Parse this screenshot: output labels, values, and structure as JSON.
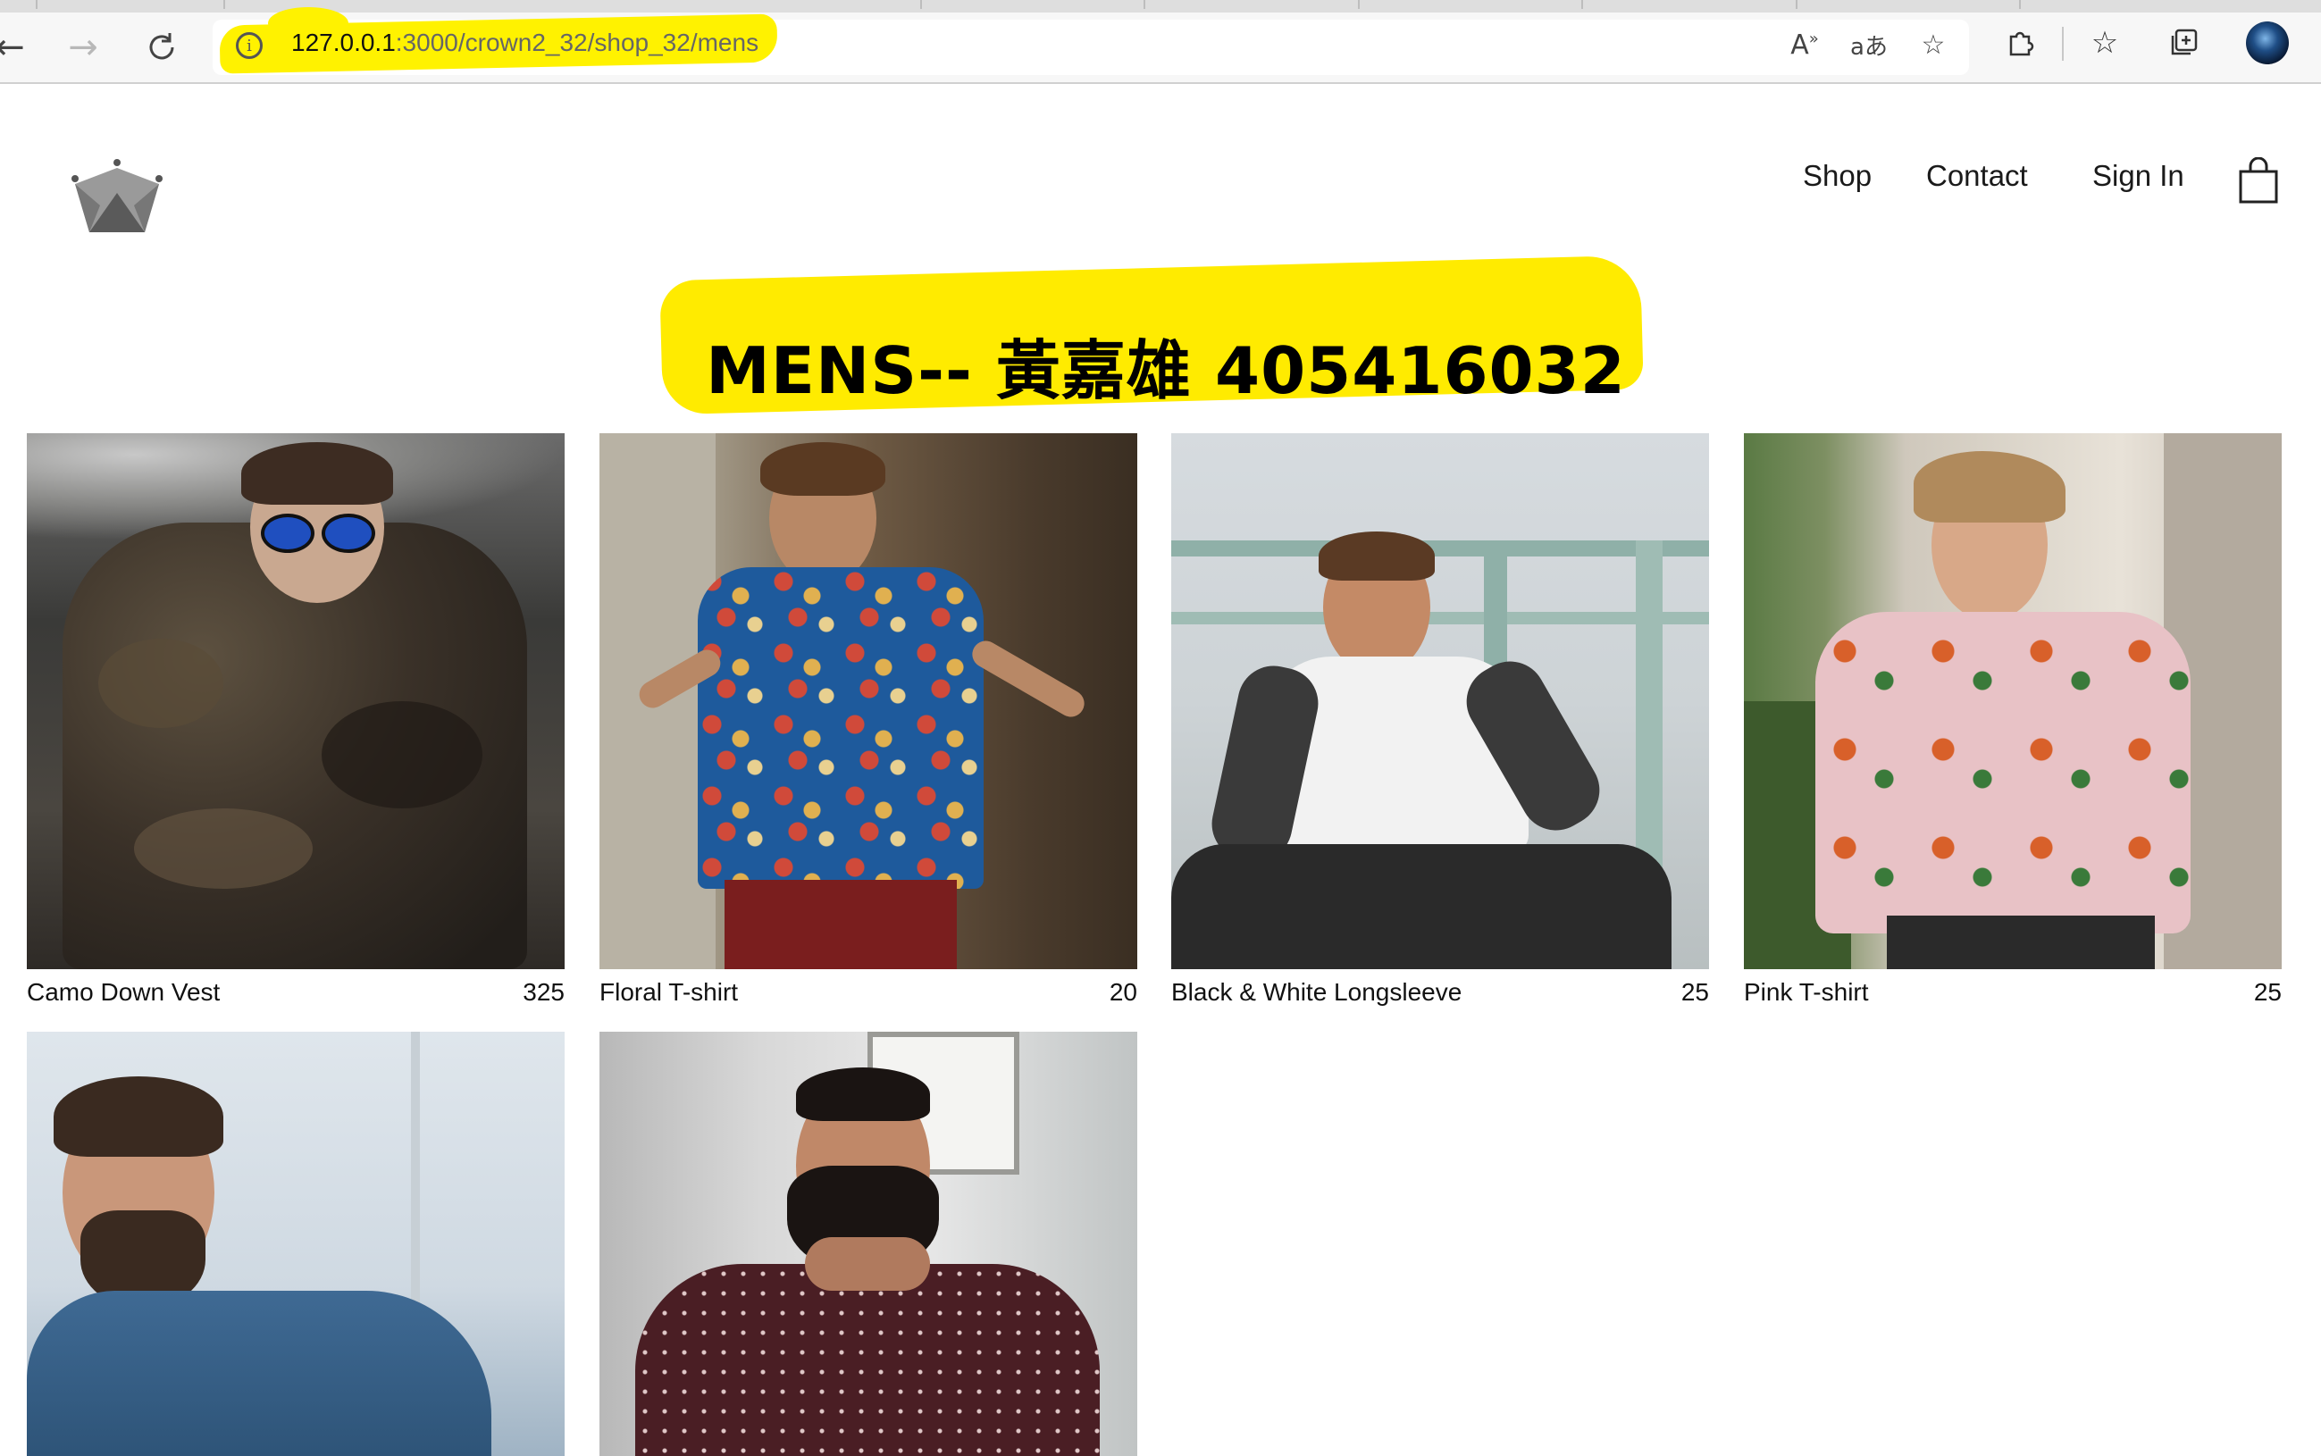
{
  "browser": {
    "url_host": "127.0.0.1",
    "url_path": ":3000/crown2_32/shop_32/mens"
  },
  "header": {
    "nav": [
      "Shop",
      "Contact",
      "Sign In"
    ]
  },
  "page": {
    "title": "MENS-- 黃嘉雄 405416032"
  },
  "products": [
    {
      "name": "Camo Down Vest",
      "price": "325"
    },
    {
      "name": "Floral T-shirt",
      "price": "20"
    },
    {
      "name": "Black & White Longsleeve",
      "price": "25"
    },
    {
      "name": "Pink T-shirt",
      "price": "25"
    },
    {
      "name": "",
      "price": ""
    },
    {
      "name": "",
      "price": ""
    }
  ],
  "colors": {
    "highlight": "#ffeb00",
    "text": "#111111"
  }
}
